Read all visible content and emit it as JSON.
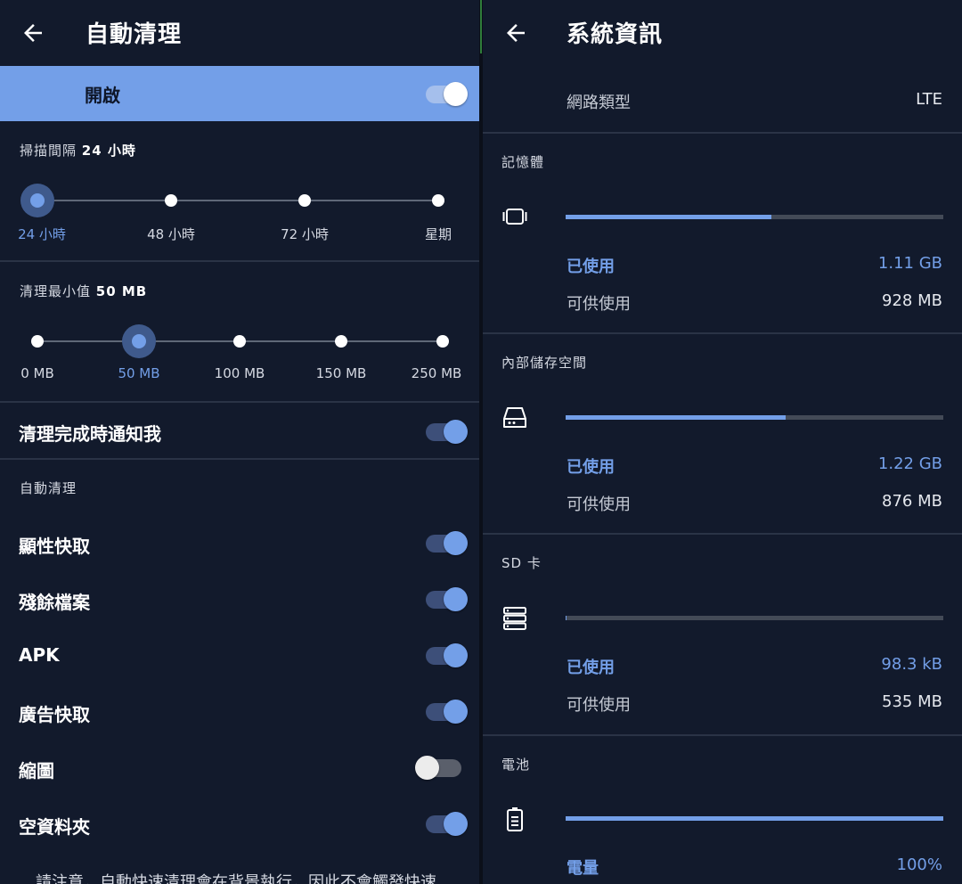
{
  "left": {
    "title": "自動清理",
    "master": {
      "label": "開啟",
      "on": true
    },
    "scan_interval": {
      "prefix": "掃描間隔 ",
      "value": "24 小時",
      "options": [
        "24 小時",
        "48 小時",
        "72 小時",
        "星期"
      ],
      "selected_index": 0
    },
    "min_clean": {
      "prefix": "清理最小值 ",
      "value": "50 MB",
      "options": [
        "0 MB",
        "50 MB",
        "100 MB",
        "150 MB",
        "250 MB"
      ],
      "selected_index": 1
    },
    "notify": {
      "label": "清理完成時通知我",
      "on": true
    },
    "auto_clean_header": "自動清理",
    "items": [
      {
        "label": "顯性快取",
        "on": true
      },
      {
        "label": "殘餘檔案",
        "on": true
      },
      {
        "label": "APK",
        "on": true
      },
      {
        "label": "廣告快取",
        "on": true
      },
      {
        "label": "縮圖",
        "on": false
      },
      {
        "label": "空資料夾",
        "on": true
      }
    ],
    "note": "請注意，自動快速清理會在背景執行，因此不會觸發快速"
  },
  "right": {
    "title": "系統資訊",
    "network": {
      "label": "網路類型",
      "value": "LTE"
    },
    "sections": [
      {
        "title": "記憶體",
        "icon": "memory-icon",
        "fraction": 0.545,
        "used_label": "已使用",
        "used": "1.11 GB",
        "avail_label": "可供使用",
        "avail": "928 MB"
      },
      {
        "title": "內部儲存空間",
        "icon": "storage-icon",
        "fraction": 0.582,
        "used_label": "已使用",
        "used": "1.22 GB",
        "avail_label": "可供使用",
        "avail": "876 MB"
      },
      {
        "title": "SD 卡",
        "icon": "sd-card-icon",
        "fraction": 0.0002,
        "used_label": "已使用",
        "used": "98.3 kB",
        "avail_label": "可供使用",
        "avail": "535 MB"
      },
      {
        "title": "電池",
        "icon": "battery-icon",
        "fraction": 1.0,
        "used_label": "電量",
        "used": "100%"
      }
    ]
  },
  "colors": {
    "background": "#121a2c",
    "accent": "#739fe8",
    "highlight_row": "#739fe8",
    "divider": "#2a3346"
  }
}
